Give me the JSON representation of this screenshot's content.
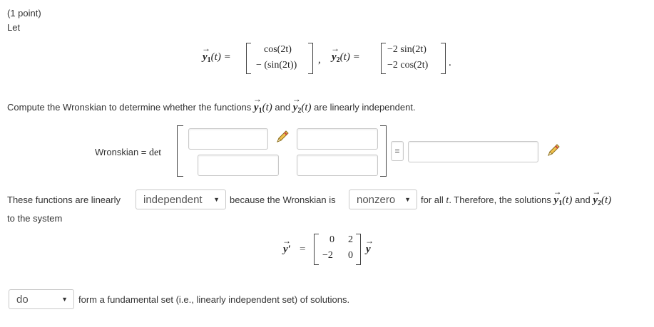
{
  "header": {
    "points": "(1 point)",
    "let": "Let"
  },
  "definition": {
    "y1_label": "y",
    "y1_sub": "1",
    "y1_arg": "(t) =",
    "y1_top": "cos(2t)",
    "y1_bottom": "− (sin(2t))",
    "sep": ",",
    "y2_label": "y",
    "y2_sub": "2",
    "y2_arg": "(t) =",
    "y2_top": "−2 sin(2t)",
    "y2_bottom": "−2 cos(2t)",
    "period": "."
  },
  "question": {
    "prefix": "Compute the Wronskian to determine whether the functions",
    "y1": "y",
    "y1_sub": "1",
    "y1_arg": "(t)",
    "and": "and",
    "y2": "y",
    "y2_sub": "2",
    "y2_arg": "(t)",
    "suffix": "are linearly independent."
  },
  "wronskian": {
    "label": "Wronskian = ",
    "det": "det",
    "equals": "=",
    "inputs": [
      "",
      "",
      "",
      "",
      ""
    ]
  },
  "sentence": {
    "part1": "These functions are linearly",
    "select1_value": "independent",
    "part2": "because the Wronskian is",
    "select2_value": "nonzero",
    "part3": "for all",
    "t": "t",
    "part4": ". Therefore, the solutions",
    "y1": "y",
    "y1_sub": "1",
    "y1_arg": "(t)",
    "and": "and",
    "y2": "y",
    "y2_sub": "2",
    "y2_arg": "(t)",
    "line2": "to the system"
  },
  "system": {
    "lhs": "y",
    "prime": "′",
    "eq": "=",
    "matrix": [
      [
        "0",
        "2"
      ],
      [
        "−2",
        "0"
      ]
    ],
    "rhs": "y"
  },
  "final": {
    "select3_value": "do",
    "text": "form a fundamental set (i.e., linearly independent set) of solutions."
  },
  "icons": {
    "pencil": "pencil-icon",
    "dropdown": "caret-down-icon"
  }
}
